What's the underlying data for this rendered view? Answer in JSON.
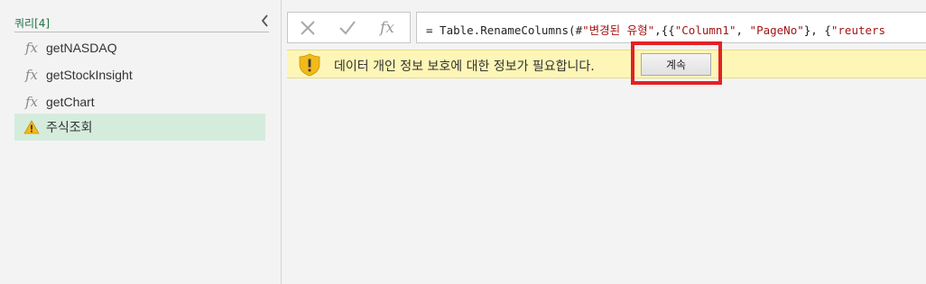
{
  "query_pane": {
    "title": "쿼리[4]",
    "collapse_glyph": "‹",
    "items": [
      {
        "label": "getNASDAQ",
        "icon": "fx-icon",
        "glyph": "fx",
        "selected": false
      },
      {
        "label": "getStockInsight",
        "icon": "fx-icon",
        "glyph": "fx",
        "selected": false
      },
      {
        "label": "getChart",
        "icon": "fx-icon",
        "glyph": "fx",
        "selected": false
      },
      {
        "label": "주식조회",
        "icon": "warning-icon",
        "glyph": "!",
        "selected": true
      }
    ]
  },
  "formula_bar": {
    "cancel_glyph": "✕",
    "confirm_glyph": "✓",
    "fx_glyph": "fx",
    "formula_prefix": "= Table.RenameColumns(#",
    "formula_str1": "\"변경된 유형\"",
    "formula_mid1": ",{{",
    "formula_str2": "\"Column1\"",
    "formula_mid2": ", ",
    "formula_str3": "\"PageNo\"",
    "formula_mid3": "}, {",
    "formula_str4": "\"reuters"
  },
  "privacy_warning": {
    "message": "데이터 개인 정보 보호에 대한 정보가 필요합니다.",
    "continue_label": "계속"
  },
  "colors": {
    "accent_green": "#217346",
    "selected_bg": "#d5ecdd",
    "warning_bar_bg": "#fdf6b6",
    "warning_icon": "#f2b91a",
    "highlight_red": "#e32124",
    "string_literal": "#a31515"
  }
}
